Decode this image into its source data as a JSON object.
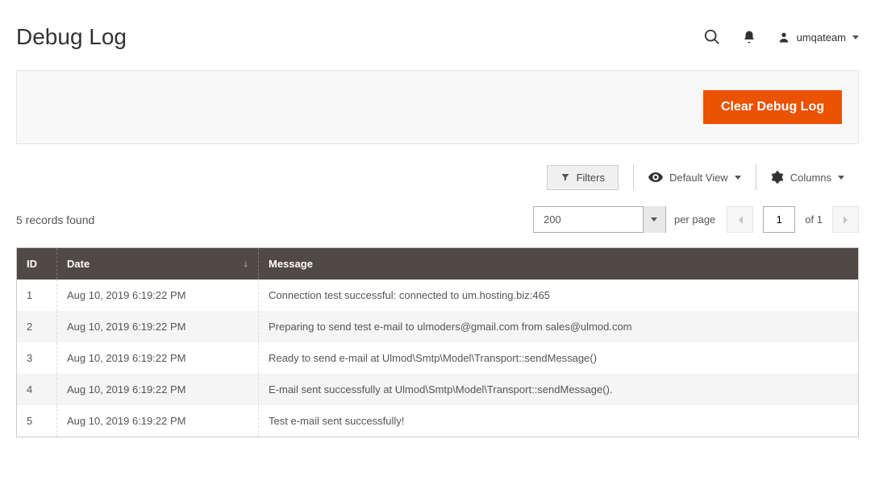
{
  "header": {
    "title": "Debug Log",
    "user_name": "umqateam"
  },
  "action_bar": {
    "clear_label": "Clear Debug Log"
  },
  "toolbar": {
    "filters_label": "Filters",
    "default_view_label": "Default View",
    "columns_label": "Columns",
    "records_found": "5 records found",
    "per_page_value": "200",
    "per_page_label": "per page",
    "page_current": "1",
    "of_label": "of",
    "page_total": "1"
  },
  "grid": {
    "columns": {
      "id": "ID",
      "date": "Date",
      "message": "Message"
    },
    "rows": [
      {
        "id": "1",
        "date": "Aug 10, 2019 6:19:22 PM",
        "message": "Connection test successful: connected to um.hosting.biz:465"
      },
      {
        "id": "2",
        "date": "Aug 10, 2019 6:19:22 PM",
        "message": "Preparing to send test e-mail to ulmoders@gmail.com from sales@ulmod.com"
      },
      {
        "id": "3",
        "date": "Aug 10, 2019 6:19:22 PM",
        "message": "Ready to send e-mail at Ulmod\\Smtp\\Model\\Transport::sendMessage()"
      },
      {
        "id": "4",
        "date": "Aug 10, 2019 6:19:22 PM",
        "message": "E-mail sent successfully at Ulmod\\Smtp\\Model\\Transport::sendMessage()."
      },
      {
        "id": "5",
        "date": "Aug 10, 2019 6:19:22 PM",
        "message": "Test e-mail sent successfully!"
      }
    ]
  }
}
